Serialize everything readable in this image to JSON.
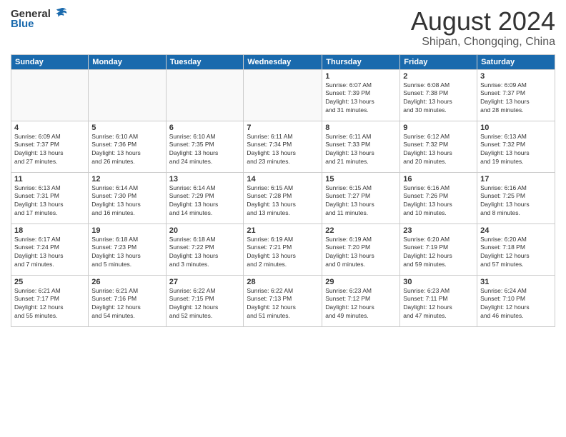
{
  "header": {
    "logo_general": "General",
    "logo_blue": "Blue",
    "month": "August 2024",
    "location": "Shipan, Chongqing, China"
  },
  "weekdays": [
    "Sunday",
    "Monday",
    "Tuesday",
    "Wednesday",
    "Thursday",
    "Friday",
    "Saturday"
  ],
  "weeks": [
    [
      {
        "day": "",
        "info": ""
      },
      {
        "day": "",
        "info": ""
      },
      {
        "day": "",
        "info": ""
      },
      {
        "day": "",
        "info": ""
      },
      {
        "day": "1",
        "info": "Sunrise: 6:07 AM\nSunset: 7:39 PM\nDaylight: 13 hours\nand 31 minutes."
      },
      {
        "day": "2",
        "info": "Sunrise: 6:08 AM\nSunset: 7:38 PM\nDaylight: 13 hours\nand 30 minutes."
      },
      {
        "day": "3",
        "info": "Sunrise: 6:09 AM\nSunset: 7:37 PM\nDaylight: 13 hours\nand 28 minutes."
      }
    ],
    [
      {
        "day": "4",
        "info": "Sunrise: 6:09 AM\nSunset: 7:37 PM\nDaylight: 13 hours\nand 27 minutes."
      },
      {
        "day": "5",
        "info": "Sunrise: 6:10 AM\nSunset: 7:36 PM\nDaylight: 13 hours\nand 26 minutes."
      },
      {
        "day": "6",
        "info": "Sunrise: 6:10 AM\nSunset: 7:35 PM\nDaylight: 13 hours\nand 24 minutes."
      },
      {
        "day": "7",
        "info": "Sunrise: 6:11 AM\nSunset: 7:34 PM\nDaylight: 13 hours\nand 23 minutes."
      },
      {
        "day": "8",
        "info": "Sunrise: 6:11 AM\nSunset: 7:33 PM\nDaylight: 13 hours\nand 21 minutes."
      },
      {
        "day": "9",
        "info": "Sunrise: 6:12 AM\nSunset: 7:32 PM\nDaylight: 13 hours\nand 20 minutes."
      },
      {
        "day": "10",
        "info": "Sunrise: 6:13 AM\nSunset: 7:32 PM\nDaylight: 13 hours\nand 19 minutes."
      }
    ],
    [
      {
        "day": "11",
        "info": "Sunrise: 6:13 AM\nSunset: 7:31 PM\nDaylight: 13 hours\nand 17 minutes."
      },
      {
        "day": "12",
        "info": "Sunrise: 6:14 AM\nSunset: 7:30 PM\nDaylight: 13 hours\nand 16 minutes."
      },
      {
        "day": "13",
        "info": "Sunrise: 6:14 AM\nSunset: 7:29 PM\nDaylight: 13 hours\nand 14 minutes."
      },
      {
        "day": "14",
        "info": "Sunrise: 6:15 AM\nSunset: 7:28 PM\nDaylight: 13 hours\nand 13 minutes."
      },
      {
        "day": "15",
        "info": "Sunrise: 6:15 AM\nSunset: 7:27 PM\nDaylight: 13 hours\nand 11 minutes."
      },
      {
        "day": "16",
        "info": "Sunrise: 6:16 AM\nSunset: 7:26 PM\nDaylight: 13 hours\nand 10 minutes."
      },
      {
        "day": "17",
        "info": "Sunrise: 6:16 AM\nSunset: 7:25 PM\nDaylight: 13 hours\nand 8 minutes."
      }
    ],
    [
      {
        "day": "18",
        "info": "Sunrise: 6:17 AM\nSunset: 7:24 PM\nDaylight: 13 hours\nand 7 minutes."
      },
      {
        "day": "19",
        "info": "Sunrise: 6:18 AM\nSunset: 7:23 PM\nDaylight: 13 hours\nand 5 minutes."
      },
      {
        "day": "20",
        "info": "Sunrise: 6:18 AM\nSunset: 7:22 PM\nDaylight: 13 hours\nand 3 minutes."
      },
      {
        "day": "21",
        "info": "Sunrise: 6:19 AM\nSunset: 7:21 PM\nDaylight: 13 hours\nand 2 minutes."
      },
      {
        "day": "22",
        "info": "Sunrise: 6:19 AM\nSunset: 7:20 PM\nDaylight: 13 hours\nand 0 minutes."
      },
      {
        "day": "23",
        "info": "Sunrise: 6:20 AM\nSunset: 7:19 PM\nDaylight: 12 hours\nand 59 minutes."
      },
      {
        "day": "24",
        "info": "Sunrise: 6:20 AM\nSunset: 7:18 PM\nDaylight: 12 hours\nand 57 minutes."
      }
    ],
    [
      {
        "day": "25",
        "info": "Sunrise: 6:21 AM\nSunset: 7:17 PM\nDaylight: 12 hours\nand 55 minutes."
      },
      {
        "day": "26",
        "info": "Sunrise: 6:21 AM\nSunset: 7:16 PM\nDaylight: 12 hours\nand 54 minutes."
      },
      {
        "day": "27",
        "info": "Sunrise: 6:22 AM\nSunset: 7:15 PM\nDaylight: 12 hours\nand 52 minutes."
      },
      {
        "day": "28",
        "info": "Sunrise: 6:22 AM\nSunset: 7:13 PM\nDaylight: 12 hours\nand 51 minutes."
      },
      {
        "day": "29",
        "info": "Sunrise: 6:23 AM\nSunset: 7:12 PM\nDaylight: 12 hours\nand 49 minutes."
      },
      {
        "day": "30",
        "info": "Sunrise: 6:23 AM\nSunset: 7:11 PM\nDaylight: 12 hours\nand 47 minutes."
      },
      {
        "day": "31",
        "info": "Sunrise: 6:24 AM\nSunset: 7:10 PM\nDaylight: 12 hours\nand 46 minutes."
      }
    ]
  ]
}
